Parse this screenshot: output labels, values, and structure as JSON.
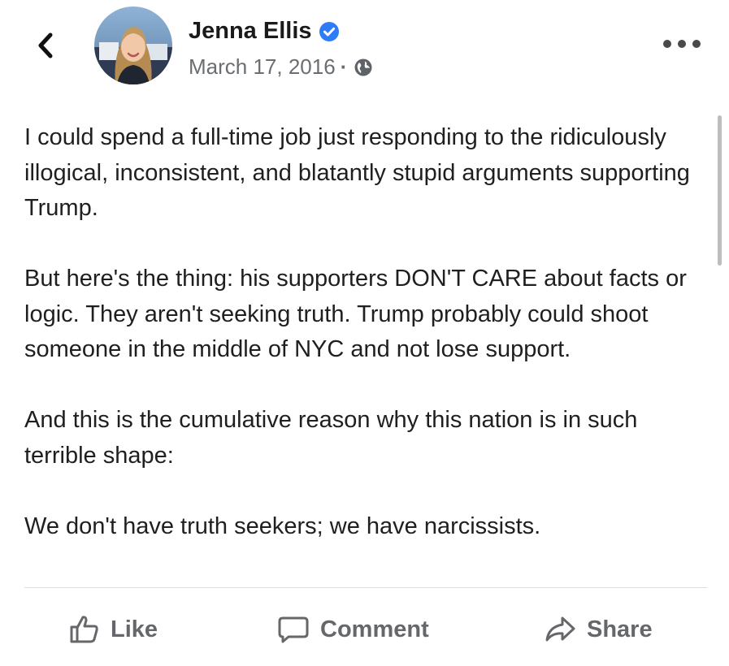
{
  "post": {
    "author": "Jenna Ellis",
    "date": "March 17, 2016",
    "separator": "·",
    "paragraphs": [
      "I could spend a full-time job just responding to the ridiculously illogical, inconsistent, and blatantly stupid arguments supporting Trump.",
      "But here's the thing: his supporters DON'T CARE about facts or logic. They aren't seeking truth. Trump probably could shoot someone in the middle of NYC and not lose support.",
      "And this is the cumulative reason why this nation is in such terrible shape:",
      "We don't have truth seekers; we have narcissists."
    ]
  },
  "actions": {
    "like": "Like",
    "comment": "Comment",
    "share": "Share"
  },
  "icons": {
    "back": "chevron-left-icon",
    "verified": "verified-badge-icon",
    "privacy": "globe-icon",
    "more": "more-horizontal-icon",
    "like": "thumbs-up-icon",
    "comment": "comment-bubble-icon",
    "share": "share-arrow-icon"
  },
  "colors": {
    "verified_badge": "#2e7cf6",
    "meta_text": "#6a6e73",
    "action_text": "#65676b"
  }
}
